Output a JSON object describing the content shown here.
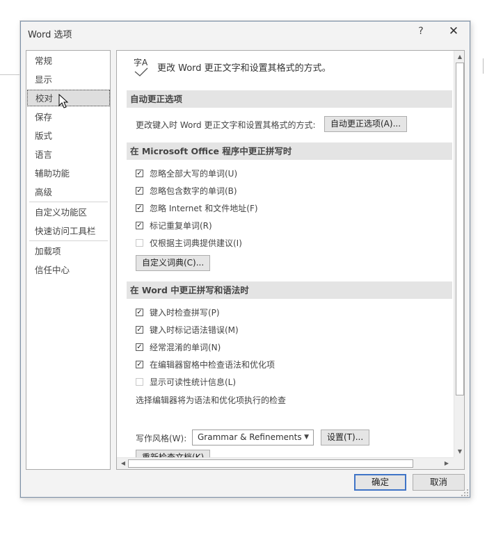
{
  "dialog": {
    "title": "Word 选项",
    "help": "?",
    "close": "✕"
  },
  "nav": {
    "items": [
      {
        "label": "常规"
      },
      {
        "label": "显示"
      },
      {
        "label": "校对",
        "selected": true
      },
      {
        "label": "保存"
      },
      {
        "label": "版式"
      },
      {
        "label": "语言"
      },
      {
        "label": "辅助功能"
      },
      {
        "label": "高级"
      },
      {
        "label": "自定义功能区"
      },
      {
        "label": "快速访问工具栏"
      },
      {
        "label": "加载项"
      },
      {
        "label": "信任中心"
      }
    ]
  },
  "header": {
    "icon_text": "字A",
    "text": "更改 Word 更正文字和设置其格式的方式。"
  },
  "autocorrect": {
    "section_title": "自动更正选项",
    "description": "更改键入时 Word 更正文字和设置其格式的方式:",
    "button": "自动更正选项(A)..."
  },
  "office_spelling": {
    "section_title": "在 Microsoft Office 程序中更正拼写时",
    "options": [
      {
        "label": "忽略全部大写的单词(U)",
        "checked": true
      },
      {
        "label": "忽略包含数字的单词(B)",
        "checked": true
      },
      {
        "label": "忽略 Internet 和文件地址(F)",
        "checked": true
      },
      {
        "label": "标记重复单词(R)",
        "checked": true
      },
      {
        "label": "仅根据主词典提供建议(I)",
        "checked": false
      }
    ],
    "dictionary_button": "自定义词典(C)..."
  },
  "word_spelling": {
    "section_title": "在 Word 中更正拼写和语法时",
    "options": [
      {
        "label": "键入时检查拼写(P)",
        "checked": true
      },
      {
        "label": "键入时标记语法错误(M)",
        "checked": true
      },
      {
        "label": "经常混淆的单词(N)",
        "checked": true
      },
      {
        "label": "在编辑器窗格中检查语法和优化项",
        "checked": true
      },
      {
        "label": "显示可读性统计信息(L)",
        "checked": false
      }
    ],
    "editor_note": "选择编辑器将为语法和优化项执行的检查",
    "writing_style_label": "写作风格(W):",
    "writing_style_value": "Grammar & Refinements",
    "settings_button": "设置(T)...",
    "recheck_button": "重新检查文档(K)"
  },
  "footer": {
    "ok": "确定",
    "cancel": "取消"
  },
  "colors": {
    "accent": "#3f74c7",
    "section_bg": "#e4e4e4",
    "selected_nav_bg": "#dedede"
  },
  "icons": [
    "help-icon",
    "close-icon",
    "abc-check-icon",
    "checkmark-icon",
    "dropdown-arrow-icon",
    "scroll-arrow-icon",
    "mouse-cursor-icon",
    "resize-grip-icon"
  ]
}
